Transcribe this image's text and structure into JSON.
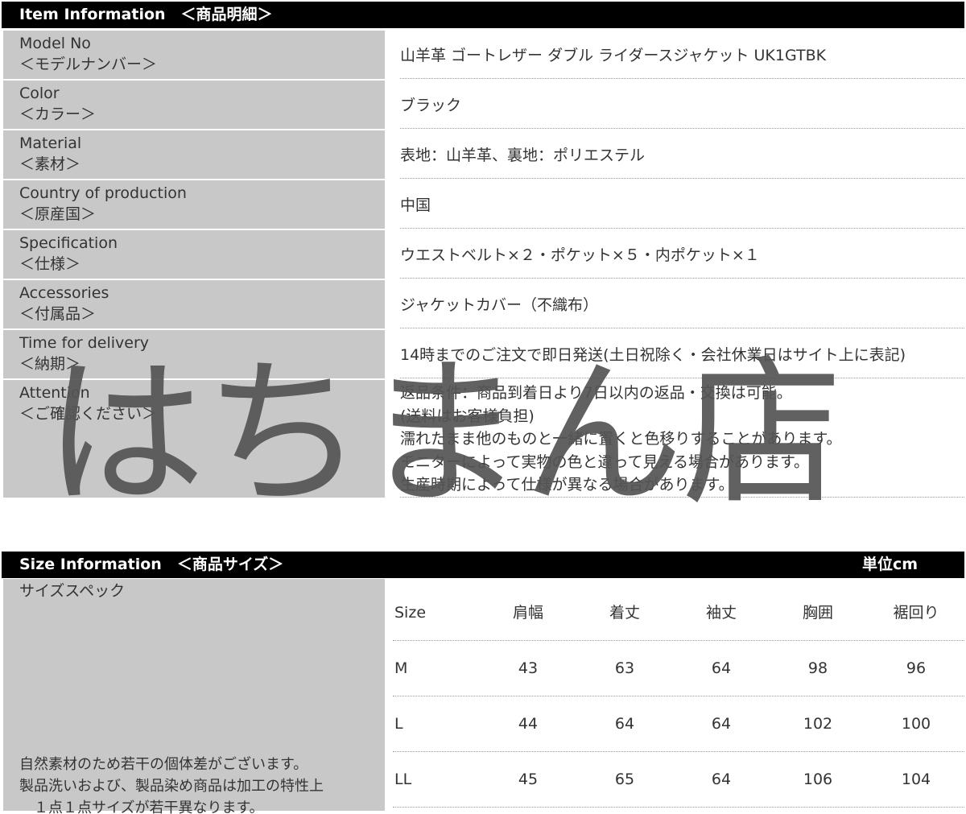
{
  "item_header": {
    "title": "Item Information　＜商品明細＞"
  },
  "item_rows": [
    {
      "label_en": "Model No",
      "label_ja": "＜モデルナンバー＞",
      "value": [
        "山羊革 ゴートレザー ダブル ライダースジャケット UK1GTBK"
      ]
    },
    {
      "label_en": "Color",
      "label_ja": "＜カラー＞",
      "value": [
        "ブラック"
      ]
    },
    {
      "label_en": "Material",
      "label_ja": "＜素材＞",
      "value": [
        "表地：山羊革、裏地：ポリエステル"
      ]
    },
    {
      "label_en": "Country of production",
      "label_ja": "＜原産国＞",
      "value": [
        "中国"
      ]
    },
    {
      "label_en": "Specification",
      "label_ja": "＜仕様＞",
      "value": [
        "ウエストベルト×２・ポケット×５・内ポケット×１"
      ]
    },
    {
      "label_en": "Accessories",
      "label_ja": "＜付属品＞",
      "value": [
        "ジャケットカバー（不織布）"
      ]
    },
    {
      "label_en": "Time for delivery",
      "label_ja": "＜納期＞",
      "value": [
        "14時までのご注文で即日発送(土日祝除く・会社休業日はサイト上に表記)"
      ]
    },
    {
      "label_en": "Attention",
      "label_ja": "＜ご確認ください＞",
      "value": [
        "返品条件：商品到着日より7日以内の返品・交換は可能。",
        "(送料はお客様負担)",
        "濡れたまま他のものと一緒に置くと色移りすることがあります。",
        "モニターによって実物の色と違って見える場合があります。",
        "生産時期によって仕様が異なる場合があります。"
      ]
    }
  ],
  "size_header": {
    "title": "Size Information　＜商品サイズ＞",
    "unit": "単位cm"
  },
  "size_label": {
    "title": "サイズスペック",
    "notes": [
      "自然素材のため若干の個体差がございます。",
      "製品洗いおよび、製品染め商品は加工の特性上",
      "　１点１点サイズが若干異なります。"
    ]
  },
  "size_table": {
    "columns": [
      "Size",
      "肩幅",
      "着丈",
      "袖丈",
      "胸囲",
      "裾回り"
    ],
    "rows": [
      [
        "M",
        "43",
        "63",
        "64",
        "98",
        "96"
      ],
      [
        "L",
        "44",
        "64",
        "64",
        "102",
        "100"
      ],
      [
        "LL",
        "45",
        "65",
        "64",
        "106",
        "104"
      ]
    ]
  },
  "watermark": {
    "text": "はちまん店"
  }
}
